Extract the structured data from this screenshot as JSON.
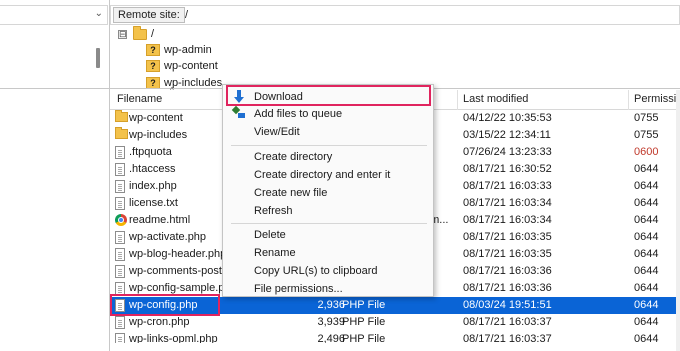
{
  "left_pane": {
    "combo_chevron": "chevron-down-icon"
  },
  "remote": {
    "label": "Remote site:",
    "path": "/"
  },
  "tree": {
    "root": "/",
    "expander": "⊟",
    "items": [
      {
        "label": "wp-admin",
        "icon": "question-folder-icon"
      },
      {
        "label": "wp-content",
        "icon": "question-folder-icon"
      },
      {
        "label": "wp-includes",
        "icon": "question-folder-icon"
      }
    ]
  },
  "list": {
    "headers": {
      "filename": "Filename",
      "last_modified": "Last modified",
      "permissions": "Permissio"
    },
    "rows": [
      {
        "name": "wp-content",
        "icon": "folder-icon",
        "size": "",
        "type": "",
        "modified": "04/12/22 10:35:53",
        "perm": "0755"
      },
      {
        "name": "wp-includes",
        "icon": "folder-icon",
        "size": "",
        "type": "",
        "modified": "03/15/22 12:34:11",
        "perm": "0755"
      },
      {
        "name": ".ftpquota",
        "icon": "file-icon",
        "size": "",
        "type": "",
        "modified": "07/26/24 13:23:33",
        "perm": "0600"
      },
      {
        "name": ".htaccess",
        "icon": "file-icon",
        "size": "",
        "type": "",
        "modified": "08/17/21 16:30:52",
        "perm": "0644"
      },
      {
        "name": "index.php",
        "icon": "file-icon",
        "size": "",
        "type": "",
        "modified": "08/17/21 16:03:33",
        "perm": "0644"
      },
      {
        "name": "license.txt",
        "icon": "file-icon",
        "size": "",
        "type": "",
        "modified": "08/17/21 16:03:34",
        "perm": "0644"
      },
      {
        "name": "readme.html",
        "icon": "chrome-icon",
        "size": "",
        "type": "um...",
        "modified": "08/17/21 16:03:34",
        "perm": "0644"
      },
      {
        "name": "wp-activate.php",
        "icon": "file-icon",
        "size": "",
        "type": "",
        "modified": "08/17/21 16:03:35",
        "perm": "0644"
      },
      {
        "name": "wp-blog-header.php",
        "icon": "file-icon",
        "size": "",
        "type": "",
        "modified": "08/17/21 16:03:35",
        "perm": "0644"
      },
      {
        "name": "wp-comments-post.",
        "icon": "file-icon",
        "size": "",
        "type": "",
        "modified": "08/17/21 16:03:36",
        "perm": "0644"
      },
      {
        "name": "wp-config-sample.p",
        "icon": "file-icon",
        "size": "",
        "type": "",
        "modified": "08/17/21 16:03:36",
        "perm": "0644"
      },
      {
        "name": "wp-config.php",
        "icon": "file-icon",
        "size": "2,936",
        "type": "PHP File",
        "modified": "08/03/24 19:51:51",
        "perm": "0644",
        "selected": true
      },
      {
        "name": "wp-cron.php",
        "icon": "file-icon",
        "size": "3,939",
        "type": "PHP File",
        "modified": "08/17/21 16:03:37",
        "perm": "0644"
      },
      {
        "name": "wp-links-opml.php",
        "icon": "file-icon",
        "size": "2,496",
        "type": "PHP File",
        "modified": "08/17/21 16:03:37",
        "perm": "0644"
      }
    ]
  },
  "context_menu": {
    "groups": [
      [
        {
          "label": "Download",
          "icon": "download-arrow-icon",
          "highlighted": true
        },
        {
          "label": "Add files to queue",
          "icon": "add-queue-icon"
        },
        {
          "label": "View/Edit",
          "icon": ""
        }
      ],
      [
        {
          "label": "Create directory"
        },
        {
          "label": "Create directory and enter it"
        },
        {
          "label": "Create new file"
        },
        {
          "label": "Refresh"
        }
      ],
      [
        {
          "label": "Delete"
        },
        {
          "label": "Rename"
        },
        {
          "label": "Copy URL(s) to clipboard"
        },
        {
          "label": "File permissions..."
        }
      ]
    ]
  },
  "colors": {
    "selection": "#0a64d6",
    "highlight_box": "#e0245e",
    "folder": "#f3c24b"
  }
}
